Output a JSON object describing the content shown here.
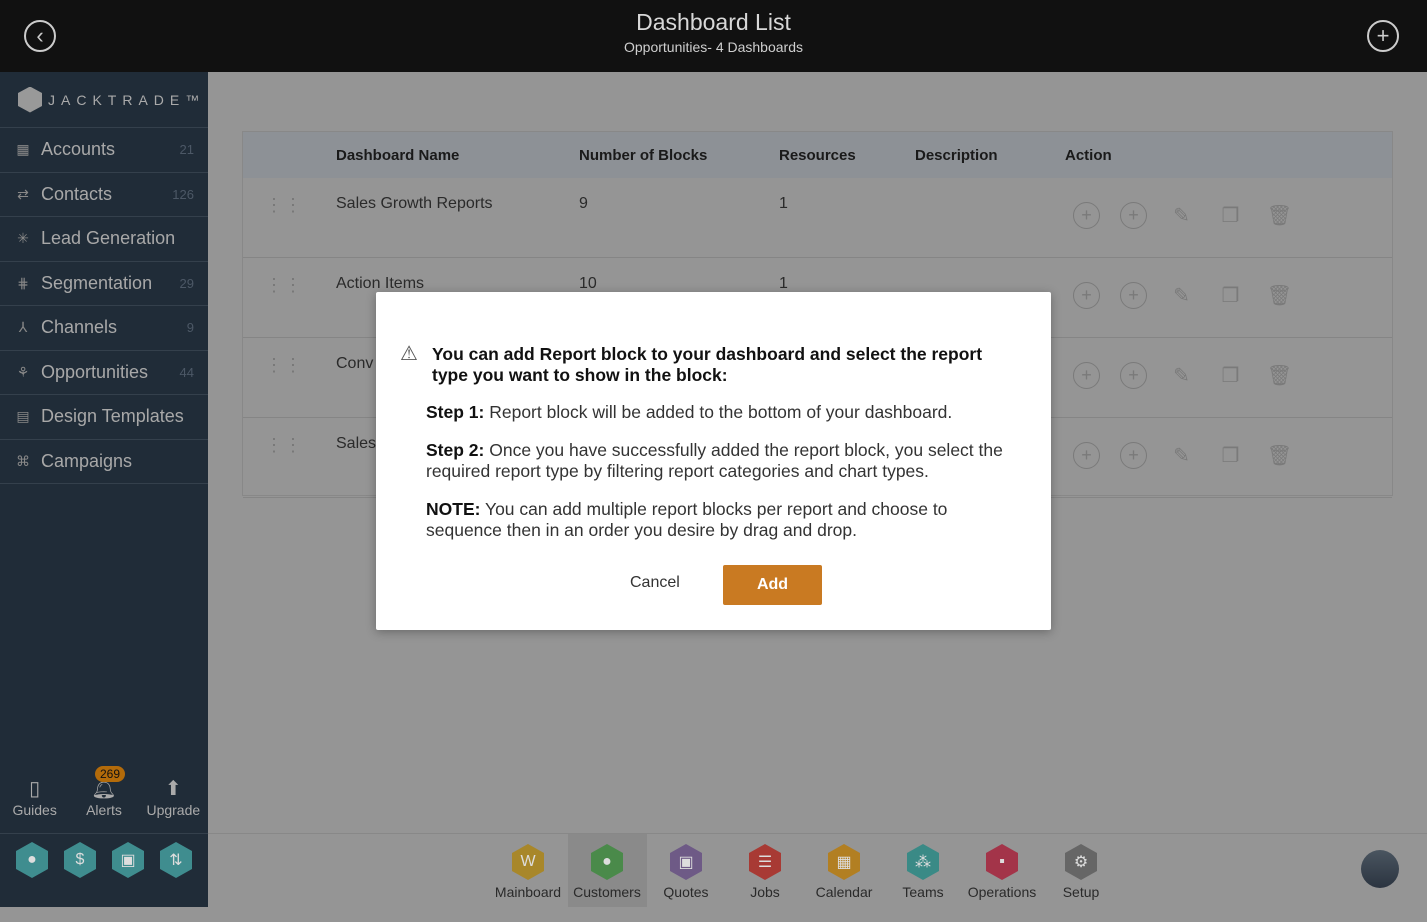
{
  "header": {
    "title": "Dashboard List",
    "subtitle": "Opportunities- 4 Dashboards",
    "back_icon": "chevron-left-circle-icon",
    "add_icon": "plus-circle-icon"
  },
  "brand": {
    "logo_text": "JACKTRADE™"
  },
  "sidebar": {
    "items": [
      {
        "label": "Accounts",
        "count": "21",
        "icon": "building-icon"
      },
      {
        "label": "Contacts",
        "count": "126",
        "icon": "contacts-icon"
      },
      {
        "label": "Lead Generation",
        "count": "",
        "icon": "lead-icon"
      },
      {
        "label": "Segmentation",
        "count": "29",
        "icon": "segmentation-icon"
      },
      {
        "label": "Channels",
        "count": "9",
        "icon": "channels-icon"
      },
      {
        "label": "Opportunities",
        "count": "44",
        "icon": "opportunities-icon"
      },
      {
        "label": "Design Templates",
        "count": "",
        "icon": "templates-icon"
      },
      {
        "label": "Campaigns",
        "count": "",
        "icon": "campaigns-icon"
      }
    ],
    "bottom": [
      {
        "label": "Guides"
      },
      {
        "label": "Alerts",
        "badge": "269"
      },
      {
        "label": "Upgrade"
      }
    ],
    "hex_colors": [
      "#3f8d8f",
      "#3f8d8f",
      "#3f8d8f",
      "#3f8d8f"
    ]
  },
  "table": {
    "columns": [
      "Dashboard Name",
      "Number of Blocks",
      "Resources",
      "Description",
      "Action"
    ],
    "rows": [
      {
        "name": "Sales Growth Reports",
        "blocks": "9",
        "resources": "1"
      },
      {
        "name": "Action Items",
        "blocks": "10",
        "resources": "1"
      },
      {
        "name": "Conv",
        "blocks": "",
        "resources": ""
      },
      {
        "name": "Sales",
        "blocks": "",
        "resources": ""
      }
    ]
  },
  "modal": {
    "heading": "You can add Report block to your dashboard and select the report type you want to show in the block:",
    "step1_label": "Step 1:",
    "step1": " Report block will be added to the bottom of your dashboard.",
    "step2_label": "Step 2:",
    "step2": " Once you have successfully added the report block, you select the required report type by filtering report categories and chart types.",
    "note_label": "NOTE:",
    "note": " You can add multiple report blocks per report and choose to sequence then in an order you desire by drag and drop.",
    "cancel": "Cancel",
    "add": "Add",
    "accent": "#c97a22"
  },
  "apps": [
    {
      "label": "Mainboard",
      "color": "#a8872a"
    },
    {
      "label": "Customers",
      "color": "#4a8a4a",
      "active": true
    },
    {
      "label": "Quotes",
      "color": "#6e5a86"
    },
    {
      "label": "Jobs",
      "color": "#a83a34"
    },
    {
      "label": "Calendar",
      "color": "#b27f22"
    },
    {
      "label": "Teams",
      "color": "#3a8a86"
    },
    {
      "label": "Operations",
      "color": "#a33449"
    },
    {
      "label": "Setup",
      "color": "#666666"
    }
  ]
}
